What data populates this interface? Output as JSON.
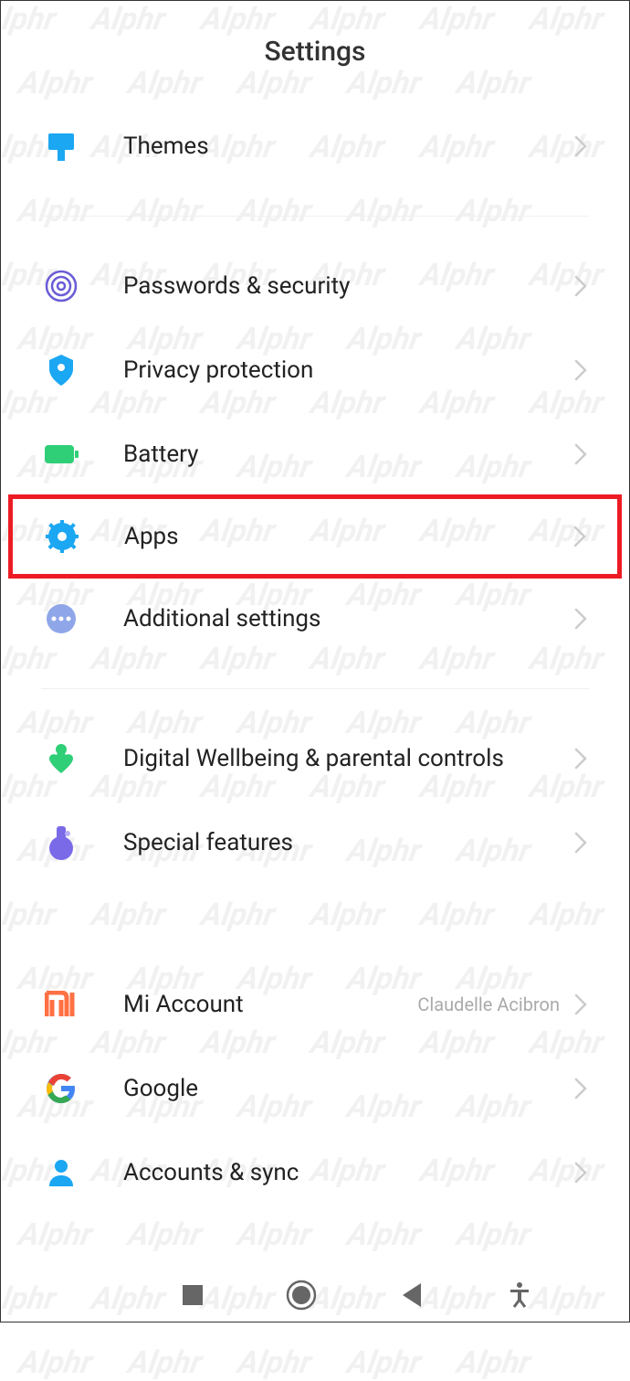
{
  "header": {
    "title": "Settings"
  },
  "groups": [
    {
      "items": [
        {
          "icon": "themes",
          "label": "Themes"
        }
      ]
    },
    {
      "items": [
        {
          "icon": "passwords",
          "label": "Passwords & security"
        },
        {
          "icon": "privacy",
          "label": "Privacy protection"
        },
        {
          "icon": "battery",
          "label": "Battery"
        },
        {
          "icon": "apps",
          "label": "Apps",
          "highlighted": true
        },
        {
          "icon": "additional",
          "label": "Additional settings"
        }
      ]
    },
    {
      "items": [
        {
          "icon": "wellbeing",
          "label": "Digital Wellbeing & parental controls"
        },
        {
          "icon": "special",
          "label": "Special features"
        }
      ]
    },
    {
      "items": [
        {
          "icon": "mi",
          "label": "Mi Account",
          "sub": "Claudelle Acibron"
        },
        {
          "icon": "google",
          "label": "Google"
        },
        {
          "icon": "accounts",
          "label": "Accounts & sync"
        }
      ]
    }
  ],
  "watermark_text": "Alphr"
}
